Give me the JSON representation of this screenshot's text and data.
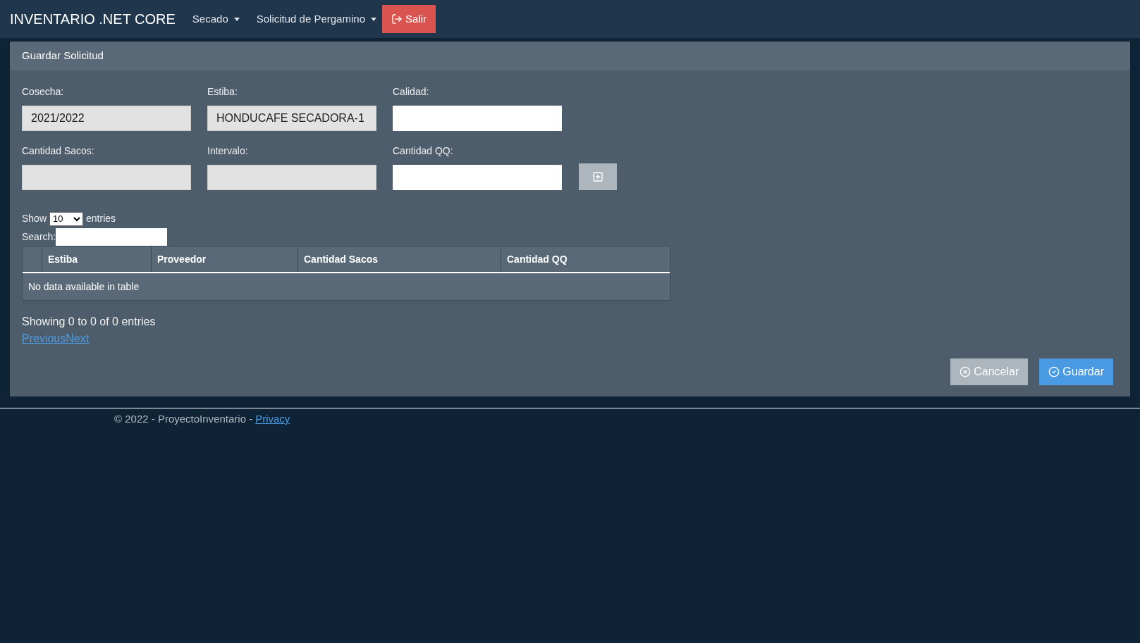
{
  "navbar": {
    "brand": "INVENTARIO .NET CORE",
    "menus": [
      {
        "label": "Secado"
      },
      {
        "label": "Solicitud de Pergamino"
      }
    ],
    "logout": "Salir"
  },
  "card": {
    "title": "Guardar Solicitud",
    "fields": [
      {
        "label": "Cosecha:",
        "value": "2021/2022",
        "disabled": true
      },
      {
        "label": "Estiba:",
        "value": "HONDUCAFE SECADORA-1",
        "disabled": true
      },
      {
        "label": "Calidad:",
        "disabled": false
      },
      {
        "label": "Cantidad Sacos:",
        "disabled": true
      },
      {
        "label": "Intervalo:",
        "disabled": true
      },
      {
        "label": "Cantidad QQ:",
        "disabled": false
      }
    ],
    "table": {
      "show_label": "Show",
      "page_size": "10",
      "entries_label": "entries",
      "search_label": "Search:",
      "columns": [
        "Estiba",
        "Proveedor",
        "Cantidad Sacos",
        "Cantidad QQ"
      ],
      "empty_message": "No data available in table",
      "info": "Showing 0 to 0 of 0 entries",
      "previous": "Previous",
      "next": "Next"
    },
    "buttons": [
      {
        "label": "Cancelar",
        "kind": "cancel"
      },
      {
        "label": "Guardar",
        "kind": "save"
      }
    ]
  },
  "footer": {
    "text": "© 2022 - ProyectoInventario -",
    "link": "Privacy"
  }
}
